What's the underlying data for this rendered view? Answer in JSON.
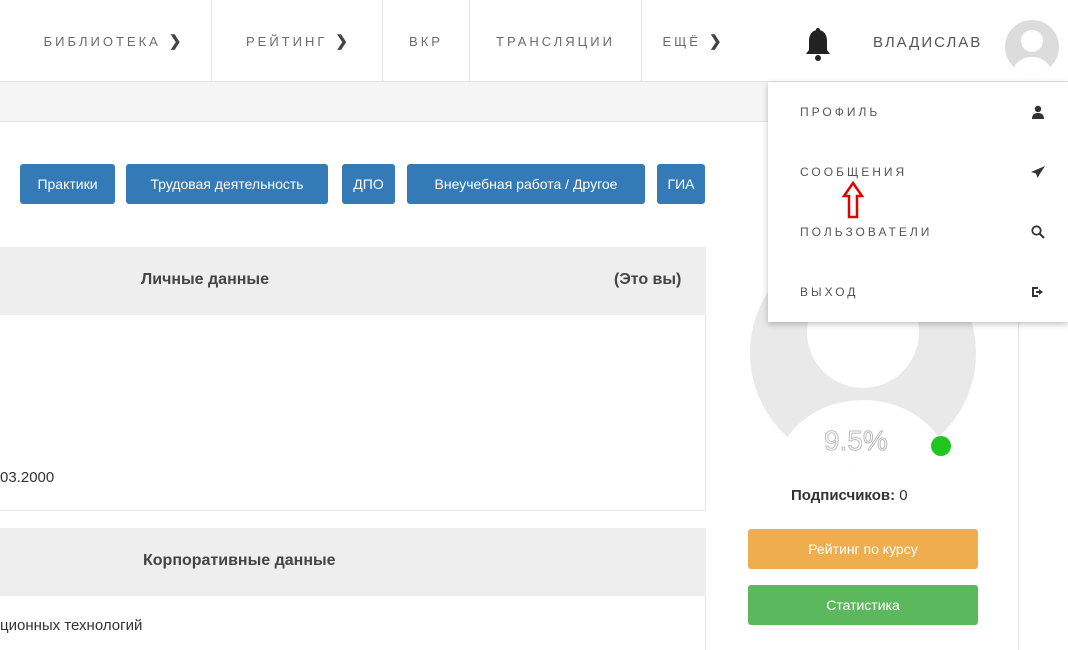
{
  "nav": {
    "items": [
      {
        "label": "БИБЛИОТЕКА",
        "chevron": "❯"
      },
      {
        "label": "РЕЙТИНГ",
        "chevron": "❯"
      },
      {
        "label": "ВКР",
        "chevron": ""
      },
      {
        "label": "ТРАНСЛЯЦИИ",
        "chevron": ""
      },
      {
        "label": "ЕЩЁ",
        "chevron": "❯"
      }
    ],
    "bell_icon": "bell-icon",
    "user_name": "ВЛАДИСЛАВ"
  },
  "tabs": [
    "Практики",
    "Трудовая деятельность",
    "ДПО",
    "Внеучебная работа / Другое",
    "ГИА"
  ],
  "personal": {
    "title": "Личные данные",
    "badge": "(Это вы)",
    "birth_date_partial": "03.2000"
  },
  "corporate": {
    "title": "Корпоративные данные",
    "department_partial": "ционных технологий"
  },
  "sidebar": {
    "progress_text": "9.5%",
    "subscribers_label": "Подписчиков:",
    "subscribers_value": "0",
    "rating_button": "Рейтинг по курсу",
    "stats_button": "Статистика"
  },
  "dropdown": {
    "items": [
      {
        "label": "ПРОФИЛЬ",
        "icon": "user-icon"
      },
      {
        "label": "СООБЩЕНИЯ",
        "icon": "send-icon"
      },
      {
        "label": "ПОЛЬЗОВАТЕЛИ",
        "icon": "search-icon"
      },
      {
        "label": "ВЫХОД",
        "icon": "logout-icon"
      }
    ]
  },
  "colors": {
    "primary_button": "#337ab7",
    "rating_button": "#f0ad4e",
    "stats_button": "#5cb85c",
    "online_status": "#1ec61e",
    "annotation_arrow": "#e00000"
  }
}
